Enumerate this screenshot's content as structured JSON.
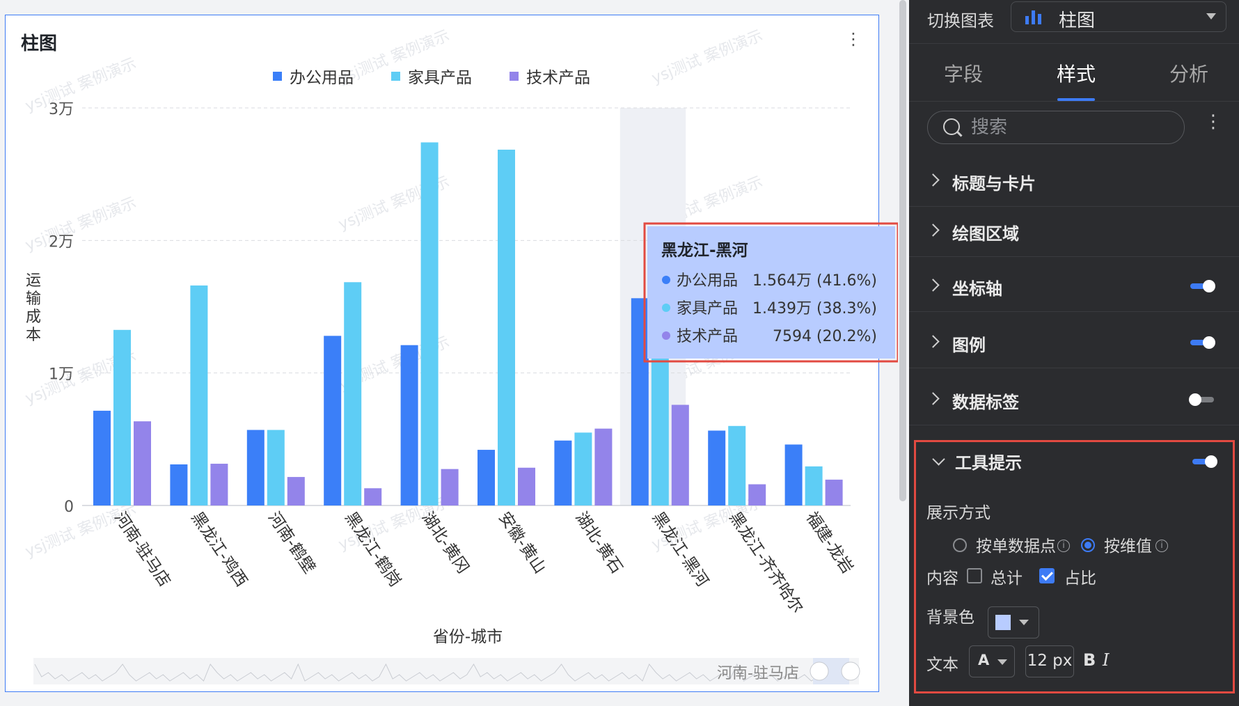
{
  "chart_card": {
    "title": "柱图",
    "more_icon": "more-vertical-icon",
    "watermark": "ysj测试 案例演示"
  },
  "chart_data": {
    "type": "bar",
    "categories": [
      "河南-驻马店",
      "黑龙江-鸡西",
      "河南-鹤壁",
      "黑龙江-鹤岗",
      "湖北-黄冈",
      "安徽-黄山",
      "湖北-黄石",
      "黑龙江-黑河",
      "黑龙江-齐齐哈尔",
      "福建-龙岩"
    ],
    "series": [
      {
        "name": "办公用品",
        "color": "#3b7ff8",
        "values": [
          7150,
          3100,
          5700,
          12800,
          12100,
          4200,
          4900,
          15640,
          5650,
          4600
        ]
      },
      {
        "name": "家具产品",
        "color": "#5ecdf5",
        "values": [
          13250,
          16600,
          5700,
          16850,
          27400,
          26850,
          5500,
          14390,
          6000,
          2950
        ]
      },
      {
        "name": "技术产品",
        "color": "#9384ea",
        "values": [
          6350,
          3150,
          2150,
          1300,
          2750,
          2850,
          5800,
          7594,
          1600,
          1950
        ]
      }
    ],
    "ylim": [
      0,
      30000
    ],
    "yticks": [
      {
        "value": 0,
        "label": "0"
      },
      {
        "value": 10000,
        "label": "1万"
      },
      {
        "value": 20000,
        "label": "2万"
      },
      {
        "value": 30000,
        "label": "3万"
      }
    ],
    "xlabel": "省份-城市",
    "ylabel": "运输成本",
    "legend_position": "top-center",
    "grid": true,
    "highlight_category": "黑龙江-黑河",
    "tooltip": {
      "title": "黑龙江-黑河",
      "rows": [
        {
          "name": "办公用品",
          "value": "1.564万 (41.6%)"
        },
        {
          "name": "家具产品",
          "value": "1.439万 (38.3%)"
        },
        {
          "name": "技术产品",
          "value": "7594 (20.2%)"
        }
      ],
      "background": "#b8ccff"
    },
    "thumbnail_label": "河南-驻马店"
  },
  "panel": {
    "switch_label": "切换图表",
    "chart_type": "柱图",
    "tabs": [
      "字段",
      "样式",
      "分析"
    ],
    "active_tab": "样式",
    "search_placeholder": "搜索",
    "sections": [
      {
        "label": "标题与卡片",
        "toggle": null
      },
      {
        "label": "绘图区域",
        "toggle": null
      },
      {
        "label": "坐标轴",
        "toggle": "on"
      },
      {
        "label": "图例",
        "toggle": "on"
      },
      {
        "label": "数据标签",
        "toggle": "off"
      }
    ],
    "tooltip_section": {
      "label": "工具提示",
      "toggle": "on",
      "display_label": "展示方式",
      "option_point": "按单数据点",
      "option_dimension": "按维值",
      "selected_option": "按维值",
      "content_label": "内容",
      "content_total": "总计",
      "content_total_checked": false,
      "content_ratio": "占比",
      "content_ratio_checked": true,
      "bg_label": "背景色",
      "bg_color": "#b8ccff",
      "text_label": "文本",
      "font_symbol": "A",
      "font_size": "12 px",
      "bold": "B",
      "italic": "I"
    }
  }
}
